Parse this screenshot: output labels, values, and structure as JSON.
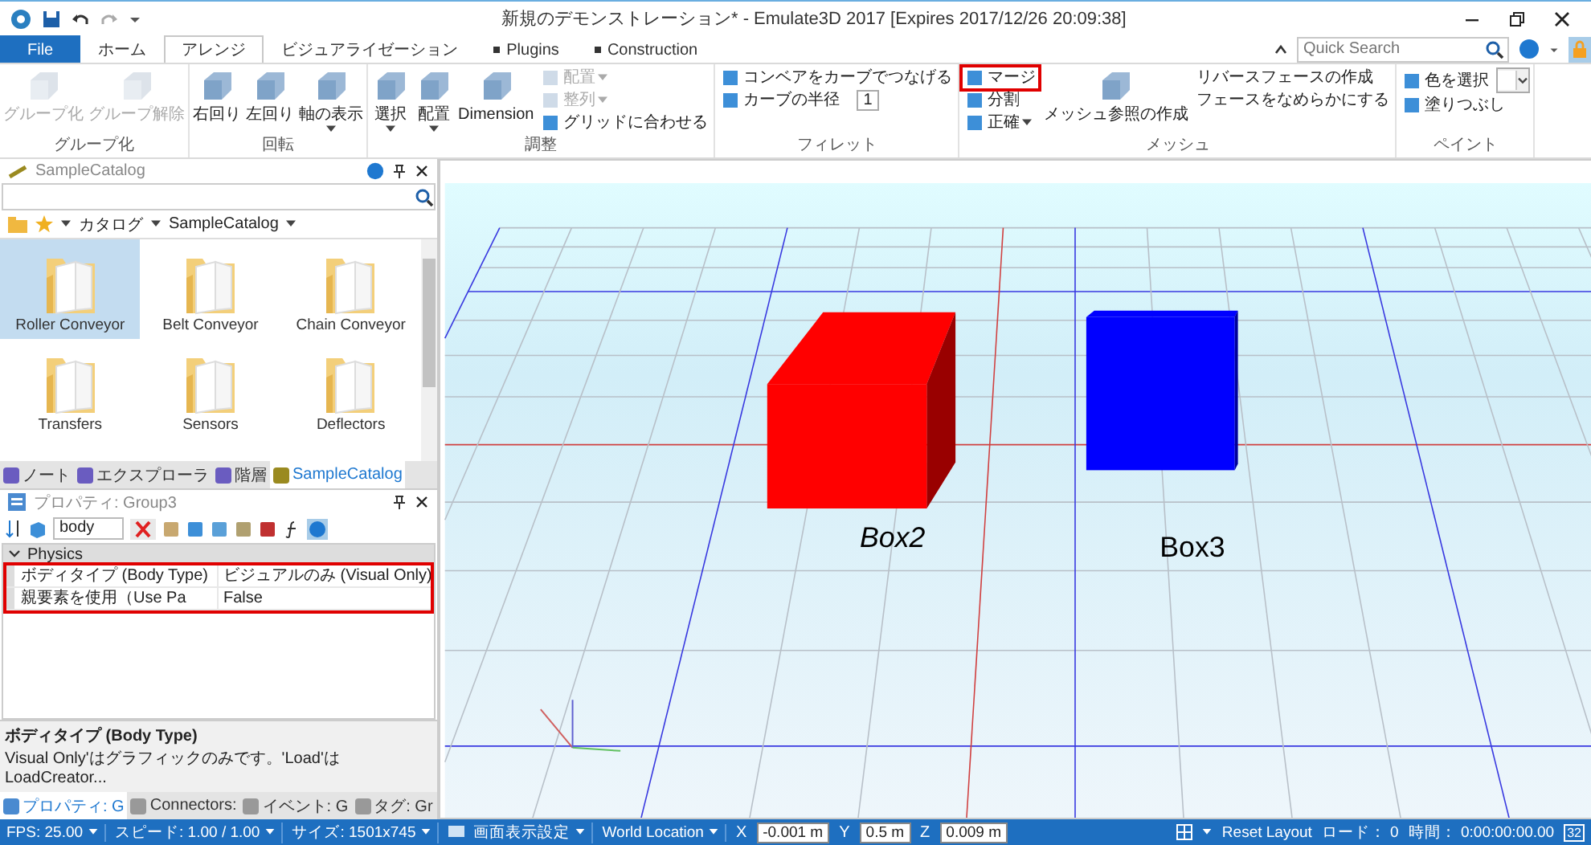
{
  "window": {
    "title": "新規のデモンストレーション* - Emulate3D 2017 [Expires 2017/12/26 20:09:38]"
  },
  "tabs": [
    {
      "label": "File",
      "kind": "file",
      "selected": false
    },
    {
      "label": "ホーム",
      "kind": "tab",
      "selected": false
    },
    {
      "label": "アレンジ",
      "kind": "tab",
      "selected": true
    },
    {
      "label": "ビジュアライゼーション",
      "kind": "tab",
      "selected": false
    },
    {
      "label": "Plugins",
      "kind": "plugin",
      "selected": false
    },
    {
      "label": "Construction",
      "kind": "plugin",
      "selected": false
    }
  ],
  "quick_search": {
    "placeholder": "Quick Search"
  },
  "ribbon": {
    "groups": [
      {
        "label": "グループ化",
        "columns": [
          {
            "kind": "large",
            "items": [
              {
                "label": "グループ化",
                "disabled": true,
                "dropdown": false,
                "highlighted": false
              },
              {
                "label": "グループ解除",
                "disabled": true,
                "dropdown": false,
                "highlighted": false
              }
            ]
          }
        ]
      },
      {
        "label": "回転",
        "columns": [
          {
            "kind": "large",
            "items": [
              {
                "label": "右回り",
                "disabled": false,
                "dropdown": false,
                "highlighted": false
              },
              {
                "label": "左回り",
                "disabled": false,
                "dropdown": false,
                "highlighted": false
              },
              {
                "label": "軸の表示",
                "disabled": false,
                "dropdown": true,
                "highlighted": false
              }
            ]
          }
        ]
      },
      {
        "label": "調整",
        "columns": [
          {
            "kind": "large",
            "items": [
              {
                "label": "選択",
                "disabled": false,
                "dropdown": true,
                "highlighted": false
              },
              {
                "label": "配置",
                "disabled": false,
                "dropdown": true,
                "highlighted": false
              },
              {
                "label": "Dimension",
                "disabled": false,
                "dropdown": false,
                "highlighted": false
              }
            ]
          },
          {
            "kind": "small",
            "items": [
              {
                "label": "配置",
                "kind": "button",
                "disabled": true,
                "dropdown": true,
                "highlighted": false
              },
              {
                "label": "整列",
                "kind": "button",
                "disabled": true,
                "dropdown": true,
                "highlighted": false
              },
              {
                "label": "グリッドに合わせる",
                "kind": "button",
                "disabled": false,
                "dropdown": false,
                "highlighted": false
              }
            ]
          }
        ]
      },
      {
        "label": "フィレット",
        "columns": [
          {
            "kind": "small",
            "items": [
              {
                "label": "コンベアをカーブでつなげる",
                "kind": "button",
                "disabled": false,
                "dropdown": false,
                "highlighted": false
              },
              {
                "label": "カーブの半径",
                "kind": "spinner",
                "value": "1",
                "disabled": false,
                "dropdown": false,
                "highlighted": false
              }
            ]
          }
        ]
      },
      {
        "label": "メッシュ",
        "columns": [
          {
            "kind": "small",
            "items": [
              {
                "label": "マージ",
                "kind": "button",
                "disabled": false,
                "dropdown": false,
                "highlighted": true
              },
              {
                "label": "分割",
                "kind": "button",
                "disabled": false,
                "dropdown": false,
                "highlighted": false
              },
              {
                "label": "正確",
                "kind": "button",
                "disabled": false,
                "dropdown": true,
                "highlighted": false
              }
            ]
          },
          {
            "kind": "large",
            "items": [
              {
                "label": "メッシュ参照の作成",
                "disabled": false,
                "dropdown": false,
                "highlighted": false
              }
            ]
          },
          {
            "kind": "small",
            "items": [
              {
                "label": "リバースフェースの作成",
                "kind": "text",
                "disabled": false,
                "dropdown": false,
                "highlighted": false
              },
              {
                "label": "フェースをなめらかにする",
                "kind": "text",
                "disabled": false,
                "dropdown": false,
                "highlighted": false
              }
            ]
          }
        ]
      },
      {
        "label": "ペイント",
        "columns": [
          {
            "kind": "small",
            "items": [
              {
                "label": "色を選択",
                "kind": "color",
                "disabled": false,
                "dropdown": true,
                "highlighted": false
              },
              {
                "label": "塗りつぶし",
                "kind": "button",
                "disabled": false,
                "dropdown": false,
                "highlighted": false
              }
            ]
          }
        ]
      }
    ]
  },
  "catalog": {
    "title": "SampleCatalog",
    "breadcrumb": [
      "カタログ",
      "SampleCatalog"
    ],
    "items": [
      {
        "label": "Roller Conveyor",
        "selected": true
      },
      {
        "label": "Belt Conveyor",
        "selected": false
      },
      {
        "label": "Chain Conveyor",
        "selected": false
      },
      {
        "label": "Transfers",
        "selected": false
      },
      {
        "label": "Sensors",
        "selected": false
      },
      {
        "label": "Deflectors",
        "selected": false
      }
    ],
    "tabs": [
      {
        "label": "ノート",
        "selected": false
      },
      {
        "label": "エクスプローラ",
        "selected": false
      },
      {
        "label": "階層",
        "selected": false
      },
      {
        "label": "SampleCatalog",
        "selected": true
      }
    ]
  },
  "properties": {
    "title": "プロパティ: Group3",
    "filter": "body",
    "category": "Physics",
    "expanded": true,
    "highlighted": true,
    "rows": [
      {
        "name": "ボディタイプ (Body Type)",
        "value": "ビジュアルのみ (Visual Only)"
      },
      {
        "name": "親要素を使用（Use Pa",
        "value": "False"
      }
    ],
    "description": {
      "title": "ボディタイプ (Body Type)",
      "text": "Visual Only'はグラフィックのみです。'Load'はLoadCreator..."
    },
    "tabs": [
      {
        "label": "プロパティ: G",
        "selected": true
      },
      {
        "label": "Connectors:",
        "selected": false
      },
      {
        "label": "イベント: G",
        "selected": false
      },
      {
        "label": "タグ: Gr",
        "selected": false
      }
    ]
  },
  "viewport": {
    "objects": [
      {
        "label": "Box2",
        "color": "#ff0000"
      },
      {
        "label": "Box3",
        "color": "#0000ff"
      }
    ]
  },
  "status_bar": {
    "left": [
      {
        "label": "FPS: 25.00",
        "dropdown": true
      },
      {
        "label": "スピード: 1.00 / 1.00",
        "dropdown": true
      },
      {
        "label": "サイズ: 1501x745",
        "dropdown": true
      },
      {
        "label": "画面表示設定",
        "dropdown": true
      },
      {
        "label": "World Location",
        "dropdown": true
      }
    ],
    "coords": [
      {
        "axis": "X",
        "value": "-0.001 m"
      },
      {
        "axis": "Y",
        "value": "0.5 m"
      },
      {
        "axis": "Z",
        "value": "0.009 m"
      }
    ],
    "right": [
      "Reset Layout",
      "ロード： 0",
      "時間： 0:00:00:00.00"
    ],
    "badge": "32"
  }
}
